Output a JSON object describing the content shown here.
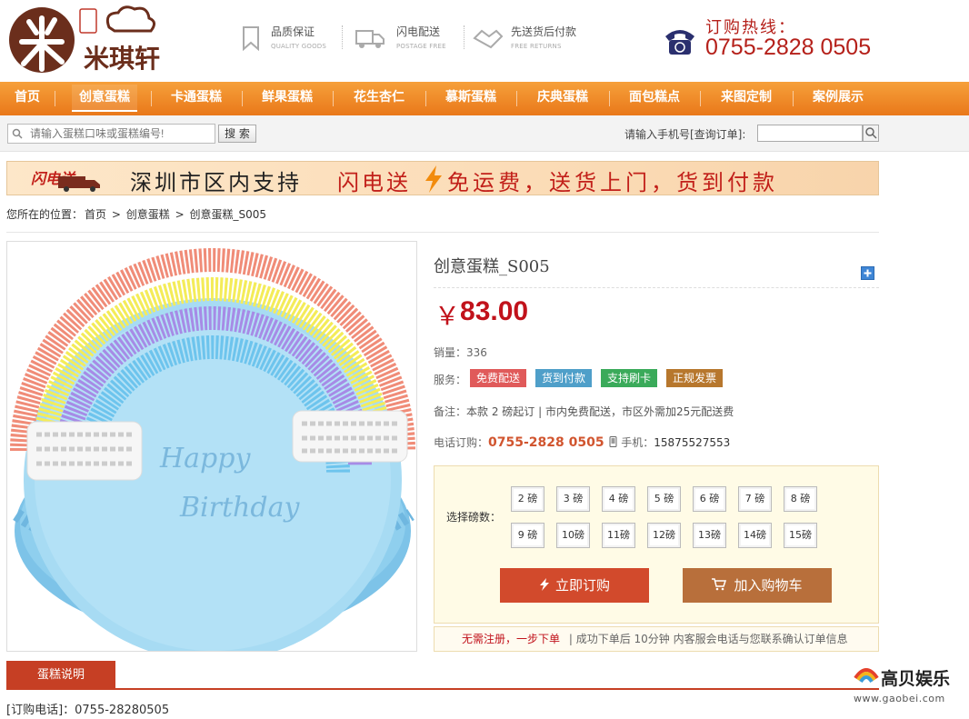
{
  "brand": {
    "name": "米琪轩",
    "colors": {
      "primary": "#6b2e1c",
      "accent": "#e9781a",
      "price": "#c1121b"
    }
  },
  "header": {
    "features": [
      {
        "title": "品质保证",
        "sub": "QUALITY GOODS",
        "icon": "bookmark-icon"
      },
      {
        "title": "闪电配送",
        "sub": "POSTAGE FREE",
        "icon": "truck-icon"
      },
      {
        "title": "先送货后付款",
        "sub": "FREE RETURNS",
        "icon": "handshake-icon"
      }
    ],
    "hotline_label": "订购热线：",
    "hotline_number": "0755-2828 0505"
  },
  "nav": {
    "items": [
      {
        "label": "首页"
      },
      {
        "label": "创意蛋糕"
      },
      {
        "label": "卡通蛋糕"
      },
      {
        "label": "鲜果蛋糕"
      },
      {
        "label": "花生杏仁"
      },
      {
        "label": "慕斯蛋糕"
      },
      {
        "label": "庆典蛋糕"
      },
      {
        "label": "面包糕点"
      },
      {
        "label": "来图定制"
      },
      {
        "label": "案例展示"
      }
    ],
    "active_index": 1
  },
  "search": {
    "placeholder": "请输入蛋糕口味或蛋糕编号!",
    "button": "搜 索",
    "order_label": "请输入手机号[查询订单]:"
  },
  "banner": {
    "tag": "闪电送",
    "text1": "深圳市区内支持",
    "text2": "闪电送",
    "text3": "免运费，送货上门，货到付款"
  },
  "breadcrumb": {
    "prefix": "您所在的位置：",
    "items": [
      "首页",
      "创意蛋糕",
      "创意蛋糕_S005"
    ],
    "sep": ">"
  },
  "product": {
    "title": "创意蛋糕_S005",
    "price_currency": "￥",
    "price": "83.00",
    "sales_label": "销量：",
    "sales": "336",
    "services_label": "服务：",
    "services": [
      {
        "label": "免费配送",
        "color": "#e05a5a"
      },
      {
        "label": "货到付款",
        "color": "#4f9fc9"
      },
      {
        "label": "支持刷卡",
        "color": "#3aaa5a"
      },
      {
        "label": "正规发票",
        "color": "#b7772d"
      }
    ],
    "note_label": "备注：",
    "note": "本款 2 磅起订 | 市内免费配送，市区外需加25元配送费",
    "phone_label": "电话订购：",
    "phone": "0755-2828 0505",
    "mobile_label": "手机：",
    "mobile": "15875527553",
    "image_text": [
      "Happy",
      "Birthday"
    ]
  },
  "options": {
    "label": "选择磅数：",
    "sizes": [
      "2 磅",
      "3 磅",
      "4 磅",
      "5 磅",
      "6 磅",
      "7 磅",
      "8 磅",
      "9 磅",
      "10磅",
      "11磅",
      "12磅",
      "13磅",
      "14磅",
      "15磅"
    ],
    "buy": "立即订购",
    "cart": "加入购物车"
  },
  "notice": {
    "highlight": "无需注册，一步下单",
    "text": "| 成功下单后 10分钟 内客服会电话与您联系确认订单信息"
  },
  "tabs": {
    "description": "蛋糕说明"
  },
  "footer": {
    "order_phone": "[订购电话]：0755-28280505"
  },
  "watermark": {
    "title": "高贝娱乐",
    "url": "www.gaobei.com"
  }
}
